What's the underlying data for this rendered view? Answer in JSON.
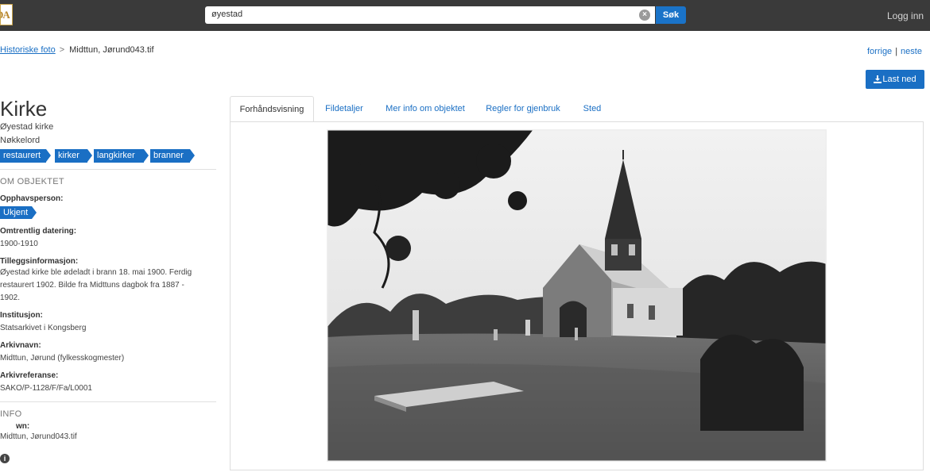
{
  "header": {
    "logo_text": "DA",
    "search_value": "øyestad",
    "search_button": "Søk",
    "clear_icon": "close-circle-icon",
    "login": "Logg inn"
  },
  "breadcrumb": {
    "parent": "Historiske foto",
    "separator": ">",
    "current": "Midttun, Jørund043.tif"
  },
  "nav": {
    "prev": "forrige",
    "divider": "|",
    "next": "neste"
  },
  "download": {
    "label": "Last ned",
    "icon": "download-icon"
  },
  "object": {
    "title": "Kirke",
    "subtitle": "Øyestad kirke",
    "keywords_label": "Nøkkelord",
    "keywords": [
      "restaurert",
      "kirker",
      "langkirker",
      "branner"
    ]
  },
  "about": {
    "heading": "OM OBJEKTET",
    "creator_label": "Opphavsperson:",
    "creator_tag": "Ukjent",
    "dating_label": "Omtrentlig datering:",
    "dating_value": "1900-1910",
    "extra_label": "Tilleggsinformasjon:",
    "extra_lines": [
      "Øyestad kirke ble ødeladt i brann 18. mai 1900. Ferdig",
      "restaurert 1902. Bilde fra Midttuns dagbok fra 1887 -",
      "1902."
    ],
    "institution_label": "Institusjon:",
    "institution_value": "Statsarkivet i Kongsberg",
    "archive_label": "Arkivnavn:",
    "archive_value": "Midttun, Jørund (fylkesskogmester)",
    "ref_label": "Arkivreferanse:",
    "ref_value": "SAKO/P-1128/F/Fa/L0001"
  },
  "info": {
    "heading": "INFO",
    "name_label": "wn:",
    "name_value": "Midttun, Jørund043.tif",
    "icon": "info-icon"
  },
  "tabs": [
    "Forhåndsvisning",
    "Fildetaljer",
    "Mer info om objektet",
    "Regler for gjenbruk",
    "Sted"
  ],
  "preview": {
    "image": "black-and-white photograph of a church with graveyard",
    "icon": "church-photo"
  }
}
